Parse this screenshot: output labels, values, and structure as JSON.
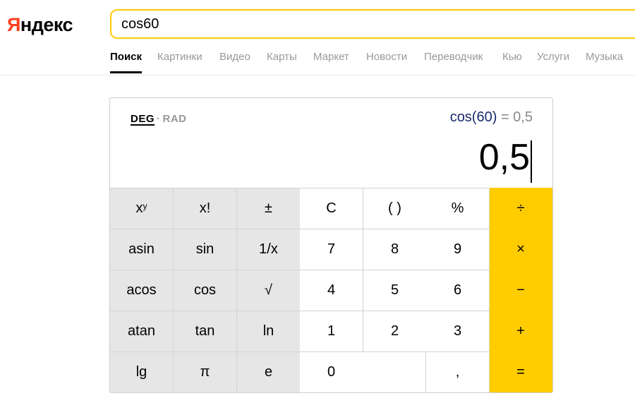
{
  "brand": {
    "first": "Я",
    "rest": "ндекс",
    "accent": "#fc3f1d"
  },
  "search": {
    "value": "cos60",
    "border_color": "#ffcc00"
  },
  "tabs": [
    "Поиск",
    "Картинки",
    "Видео",
    "Карты",
    "Маркет",
    "Новости",
    "Переводчик",
    "Кью",
    "Услуги",
    "Музыка"
  ],
  "active_tab": "Поиск",
  "calculator": {
    "mode_deg": "DEG",
    "mode_sep": "·",
    "mode_rad": "RAD",
    "active_mode": "DEG",
    "expression_fn": "cos(60)",
    "expression_rest": " = 0,5",
    "result": "0,5",
    "colors": {
      "function_key": "#e6e6e6",
      "operator_key": "#ffcc00"
    },
    "keys": {
      "pow_base": "x",
      "pow_exp": "y",
      "fact": "x!",
      "sign": "±",
      "clear": "C",
      "paren": "( )",
      "percent": "%",
      "divide": "÷",
      "asin": "asin",
      "sin": "sin",
      "reciprocal": "1/x",
      "seven": "7",
      "eight": "8",
      "nine": "9",
      "multiply": "×",
      "acos": "acos",
      "cos": "cos",
      "sqrt": "√",
      "four": "4",
      "five": "5",
      "six": "6",
      "minus": "−",
      "atan": "atan",
      "tan": "tan",
      "ln": "ln",
      "one": "1",
      "two": "2",
      "three": "3",
      "plus": "+",
      "lg": "lg",
      "pi": "π",
      "e": "e",
      "zero": "0",
      "comma": ",",
      "equals": "="
    }
  }
}
